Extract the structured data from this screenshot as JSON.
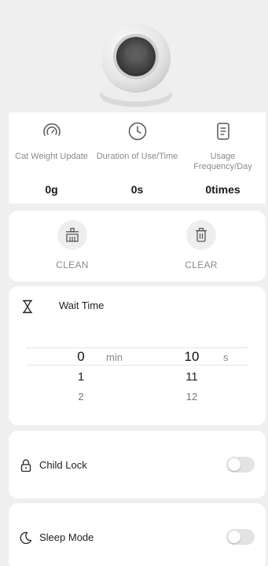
{
  "stats": [
    {
      "icon": "gauge-icon",
      "label": "Cat Weight Update",
      "value": "0g"
    },
    {
      "icon": "clock-icon",
      "label": "Duration of Use/Time",
      "value": "0s"
    },
    {
      "icon": "document-icon",
      "label": "Usage Frequency/Day",
      "value": "0times"
    }
  ],
  "actions": {
    "clean_label": "CLEAN",
    "clear_label": "CLEAR"
  },
  "wait_time": {
    "title": "Wait Time",
    "minutes": [
      "0",
      "1",
      "2"
    ],
    "minutes_unit": "min",
    "seconds": [
      "10",
      "11",
      "12"
    ],
    "seconds_unit": "s"
  },
  "child_lock": {
    "label": "Child Lock",
    "enabled": false
  },
  "sleep_mode": {
    "label": "Sleep Mode",
    "enabled": false
  }
}
